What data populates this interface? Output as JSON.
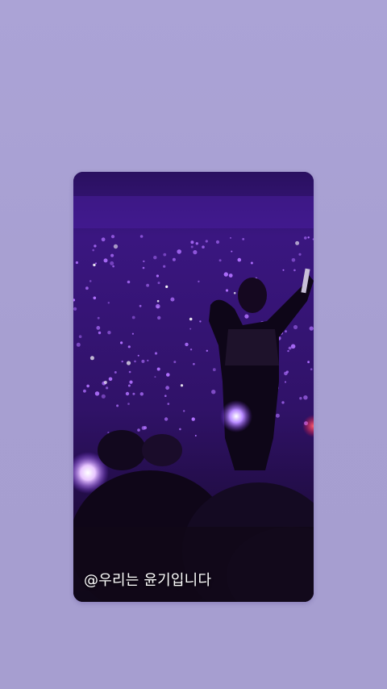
{
  "story": {
    "background_color": "#a8a0d2",
    "media": {
      "kind": "concert-video-frame",
      "scene_colors": {
        "stage_dark": "#1a0b3a",
        "crowd_purple": "#4a2a8a",
        "lightstick_glow": "#c9a6ff",
        "accent_red": "#ff2050"
      }
    },
    "caption_text": "@우리는 윤기입니다"
  }
}
